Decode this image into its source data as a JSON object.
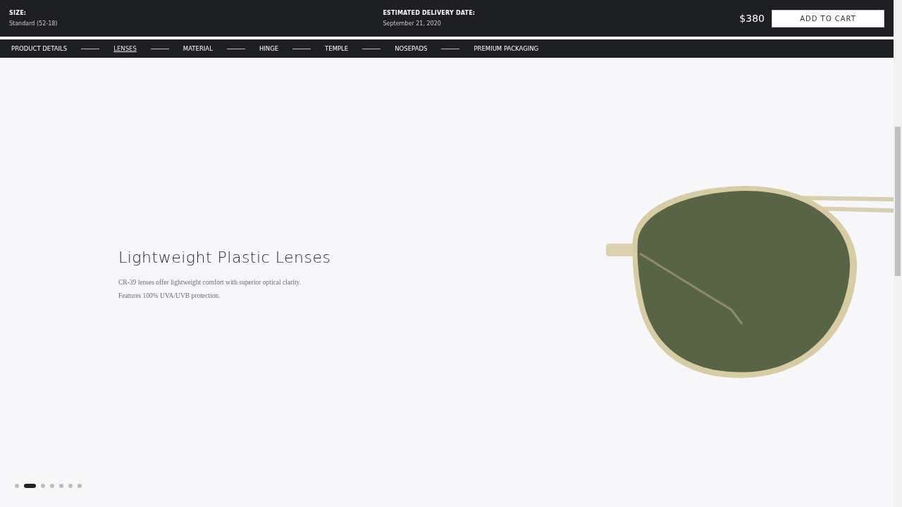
{
  "header": {
    "size_label": "SIZE:",
    "size_value": "Standard (52-18)",
    "delivery_label": "ESTIMATED DELIVERY DATE:",
    "delivery_value": "September 21, 2020",
    "price": "$380",
    "cart_button": "ADD TO CART"
  },
  "nav": [
    {
      "label": "PRODUCT DETAILS",
      "selected": false
    },
    {
      "label": "LENSES",
      "selected": true
    },
    {
      "label": "MATERIAL",
      "selected": false
    },
    {
      "label": "HINGE",
      "selected": false
    },
    {
      "label": "TEMPLE",
      "selected": false
    },
    {
      "label": "NOSEPADS",
      "selected": false
    },
    {
      "label": "PREMIUM PACKAGING",
      "selected": false
    }
  ],
  "slide": {
    "title": "Lightweight Plastic Lenses",
    "description": "CR-39 lenses offer lightweight comfort with superior optical clarity.\nFeatures 100% UVA/UVB protection."
  },
  "pager": [
    {
      "selected": false
    },
    {
      "selected": true
    },
    {
      "selected": false
    },
    {
      "selected": false
    },
    {
      "selected": false
    },
    {
      "selected": false
    },
    {
      "selected": false
    }
  ]
}
